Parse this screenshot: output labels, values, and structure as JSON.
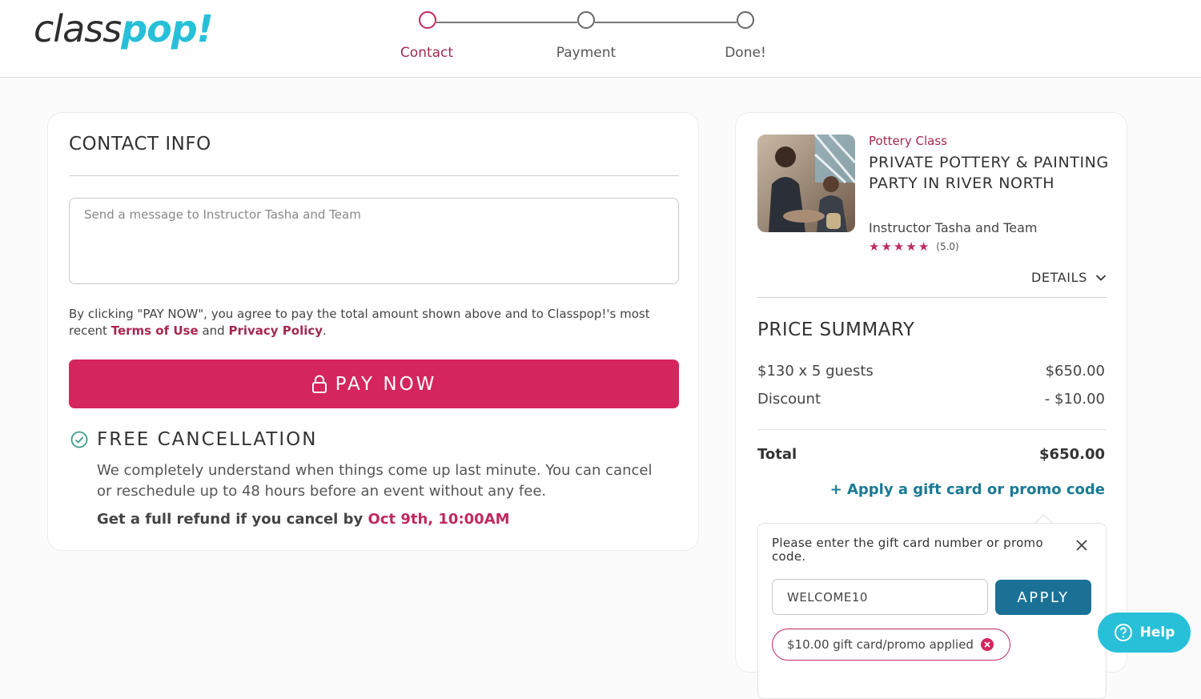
{
  "brand": {
    "logo_part1": "class",
    "logo_part2": "pop!"
  },
  "stepper": {
    "steps": [
      {
        "label": "Contact"
      },
      {
        "label": "Payment"
      },
      {
        "label": "Done!"
      }
    ]
  },
  "contact": {
    "title": "CONTACT INFO",
    "message_placeholder": "Send a message to Instructor Tasha and Team",
    "message_value": "",
    "agree_prefix": "By clicking \"PAY NOW\", you agree to pay the total amount shown above and to Classpop!'s most recent",
    "terms_link": "Terms of Use",
    "agree_and": "and",
    "privacy_link": "Privacy Policy",
    "agree_suffix": ".",
    "pay_button": "PAY NOW",
    "cancellation": {
      "title": "FREE CANCELLATION",
      "body": "We completely understand when things come up last minute. You can cancel or reschedule up to 48 hours before an event without any fee.",
      "refund_prefix": "Get a full refund if you cancel by",
      "refund_date": "Oct 9th, 10:00AM"
    }
  },
  "class_info": {
    "category": "Pottery Class",
    "title": "PRIVATE POTTERY & PAINTING PARTY IN RIVER NORTH",
    "instructor": "Instructor Tasha and Team",
    "rating": 5,
    "rating_text": "(5.0)",
    "details_label": "DETAILS"
  },
  "price_summary": {
    "title": "PRICE SUMMARY",
    "rows": [
      {
        "label": "$130 x 5 guests",
        "value": "$650.00"
      },
      {
        "label": "Discount",
        "value": "- $10.00"
      }
    ],
    "total_label": "Total",
    "total_value": "$650.00",
    "promo_link": "+ Apply a gift card or promo code"
  },
  "promo": {
    "prompt": "Please enter the gift card number or promo code.",
    "input_value": "WELCOME10",
    "apply_button": "APPLY",
    "applied_text": "$10.00 gift card/promo applied"
  },
  "help": {
    "label": "Help"
  },
  "colors": {
    "brand_pink": "#d4265d",
    "accent_maroon": "#a5294f",
    "teal": "#27c0d8",
    "link_blue": "#1b7a94",
    "apply_blue": "#1b7195"
  }
}
